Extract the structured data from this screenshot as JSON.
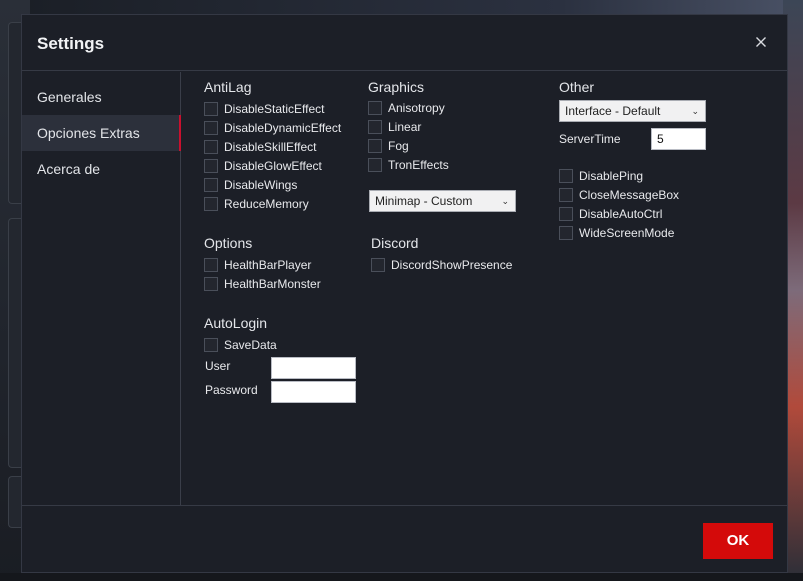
{
  "dialog": {
    "title": "Settings",
    "close_icon": "close-icon"
  },
  "sidebar": {
    "items": [
      {
        "label": "Generales"
      },
      {
        "label": "Opciones Extras",
        "active": true
      },
      {
        "label": "Acerca de"
      }
    ]
  },
  "antilag": {
    "title": "AntiLag",
    "items": [
      "DisableStaticEffect",
      "DisableDynamicEffect",
      "DisableSkillEffect",
      "DisableGlowEffect",
      "DisableWings",
      "ReduceMemory"
    ]
  },
  "graphics": {
    "title": "Graphics",
    "items": [
      "Anisotropy",
      "Linear",
      "Fog",
      "TronEffects"
    ],
    "minimap_select": "Minimap - Custom"
  },
  "other": {
    "title": "Other",
    "interface_select": "Interface - Default",
    "servertime_label": "ServerTime",
    "servertime_value": "5",
    "items": [
      "DisablePing",
      "CloseMessageBox",
      "DisableAutoCtrl",
      "WideScreenMode"
    ]
  },
  "options": {
    "title": "Options",
    "items": [
      "HealthBarPlayer",
      "HealthBarMonster"
    ]
  },
  "discord": {
    "title": "Discord",
    "items": [
      "DiscordShowPresence"
    ]
  },
  "autologin": {
    "title": "AutoLogin",
    "items": [
      "SaveData"
    ],
    "user_label": "User",
    "user_value": "",
    "password_label": "Password",
    "password_value": ""
  },
  "footer": {
    "ok_label": "OK"
  },
  "colors": {
    "accent": "#d40a0a",
    "background": "#1c1f27",
    "active_nav": "#2c303b"
  }
}
